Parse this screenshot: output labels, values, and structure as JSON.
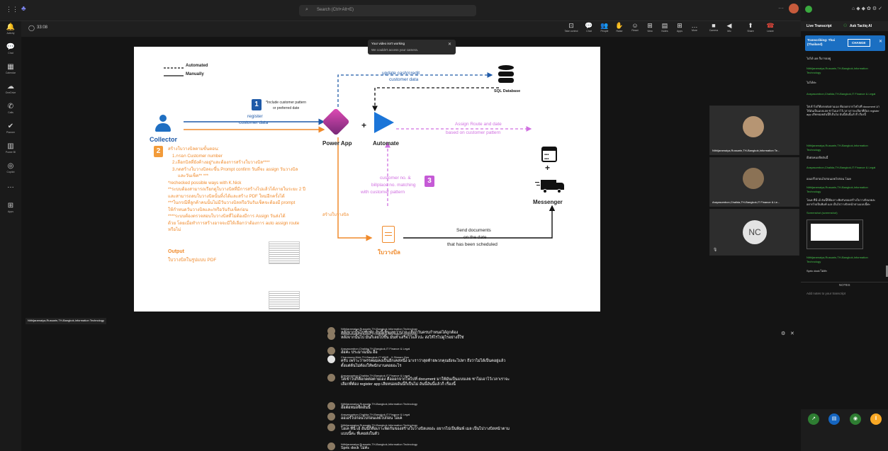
{
  "topbar": {
    "search_placeholder": "Search (Ctrl+Alt+E)"
  },
  "rail": [
    {
      "icon": "activity-icon",
      "glyph": "🔔",
      "label": "Activity"
    },
    {
      "icon": "chat-icon",
      "glyph": "💬",
      "label": "Chat"
    },
    {
      "icon": "calendar-icon",
      "glyph": "▦",
      "label": "Calendar"
    },
    {
      "icon": "onedrive-icon",
      "glyph": "☁",
      "label": "OneDrive"
    },
    {
      "icon": "calls-icon",
      "glyph": "✆",
      "label": "Calls"
    },
    {
      "icon": "planner-icon",
      "glyph": "✔",
      "label": "Planner"
    },
    {
      "icon": "powerbi-icon",
      "glyph": "▥",
      "label": "Power BI"
    },
    {
      "icon": "copilot-icon",
      "glyph": "◎",
      "label": "Copilot"
    },
    {
      "icon": "more-icon",
      "glyph": "…",
      "label": ""
    },
    {
      "icon": "apps-icon",
      "glyph": "⊞",
      "label": "Apps"
    }
  ],
  "meeting": {
    "timer": "33:08",
    "buttons": [
      {
        "name": "take-control",
        "glyph": "⊡",
        "label": "Take control"
      },
      {
        "name": "chat",
        "glyph": "💬",
        "label": "Chat"
      },
      {
        "name": "people",
        "glyph": "👥",
        "label": "People"
      },
      {
        "name": "raise",
        "glyph": "✋",
        "label": "Raise"
      },
      {
        "name": "react",
        "glyph": "☺",
        "label": "React"
      },
      {
        "name": "view",
        "glyph": "⊞",
        "label": "View"
      },
      {
        "name": "notes",
        "glyph": "▤",
        "label": "Notes"
      },
      {
        "name": "apps",
        "glyph": "⊞",
        "label": "Apps"
      },
      {
        "name": "more",
        "glyph": "…",
        "label": "More"
      },
      {
        "name": "camera",
        "glyph": "■",
        "label": "Camera"
      },
      {
        "name": "mic",
        "glyph": "◀",
        "label": "Mic"
      },
      {
        "name": "share",
        "glyph": "⬆",
        "label": "Share"
      },
      {
        "name": "leave",
        "glyph": "☎",
        "label": "Leave"
      }
    ],
    "toast_title": "Your video isn't working",
    "toast_body": "We couldn't access your camera.",
    "presenter_label": "Nithijaramaiya,Russarin,TH-Bangkok,Information Technology"
  },
  "slide": {
    "legend_automated": "Automated",
    "legend_manually": "Manually",
    "collector": "Collector",
    "step1_num": "1",
    "step1_note1": "*Include customer pattern",
    "step1_note2": "or preferred date",
    "register": "register",
    "customer_data": "customer data",
    "update1": "update cash/credit",
    "update2": "customer data",
    "sql": "SQL Database",
    "power_app": "Power App",
    "plus": "+",
    "automate": "Automate",
    "assign1": "Assign Route and date",
    "assign2": "based on customer pattern",
    "step2_num": "2",
    "notes": [
      "สร้างใบวางบิลตามขั้นตอน:",
      "1.กรอก Customer number",
      "2.เลือกบิลที่ยังค้างอยู่*และต้องการสร้างใบวางบิล****",
      "3.กดสร้างใบวางบิลจะขึ้น Prompt confirm วันที่จะ assign วันวางบิล",
      "และวันเช็ค** ***",
      "*rechecked possible ways with K.Nick",
      "**ระบบต้องสามารถเรียกดูใบวางบิลที่มีการสร้างไปแล้วได้ภายในระยะ 2 ปี",
      "และสามารถลบใบวางบิลนั้นทิ้งได้และสร้าง PDF ใหม่อีกครั้งได้",
      "***ในกรณีที่ลูกค้าคนนั้นไม่มีวันวางบิลหรือวันรับเช็คจะต้องมี prompt",
      "ให้กำหนดวันวางบิลและ/หรือวันรับเช็คก่อน",
      "****ระบบต้องตรวจสอบใบวางบิลที่ไม่ต้องมีการ Assign วันส่งได้",
      "ด้วย โดยเมื่อทำการสร้างอาจจะมีให้เลือกว่าต้องการ auto assign route",
      "หรือไม่"
    ],
    "output_title": "Output",
    "output_desc": "ใบวางบิลในรูปแบบ PDF",
    "step3_num": "3",
    "cust1": "customer no. &",
    "cust2": "billplace no. matching",
    "cust3": "with customer pattern",
    "create_bill": "สร้างใบวางบิล",
    "bill_label": "ใบวางบิล",
    "send1": "Send documents",
    "send2": "on the date",
    "send3": "that has been scheduled",
    "messenger": "Messenger"
  },
  "captions": [
    {
      "name": "Nithijaramaiya,Russarin,TH-Bangkok,Information Technology",
      "text": "หลังจากนั้นไปซักพัก อันนี้เห็นเลยว่าน่าจะเลือกวันครบกำหนดได้ถูกต้อง"
    },
    {
      "name": "Nithijaramaiya,Russarin,TH-Bangkok,Information Technology",
      "text": "หลังจากนั้นไป มันก็เลยไปขึ้น มันทำเสร็จไว้แล้วปะ ส่งให้ไรไปดูไรอย่างงี้ใช่"
    },
    {
      "name": "Arayasombon,Chalida,TH-Bangkok,IT Finance & Legal",
      "text": "อ๋อค่ะ ประมาณนั้น อือ"
    },
    {
      "name": "Chanmong,Nick,TH-Bangkok,IT WMS - X-Stream Ops",
      "text": "ครับ เพราะว่าพรรคผมคงเป็นอีกเคสหนึ่ง มาเราว่าสุดท้ายพวกคุณยังจะไปหา ถึงว่าไม่ได้เป็นคอยู่แล้วตั้งแต่ต้นไม่ต้องให้พนักงานคอยอะไร"
    },
    {
      "name": "Arayasombon,Chalida,TH-Bangkok,IT Finance & Legal",
      "text": "ใส่เข้าไปก็คือกดต่อตามเอง คือออกจากไฟไปที่ document มาให้มันเป็นแบบเลย ซาไม่เอาไว้เวลาเราจะเลือกที่ต้อง register app เสียหน่อยอันนี้ก็เป็นไม่ อันนี้อันนี้แล้วก็ เรื่องนี้"
    },
    {
      "name": "Nithijaramaiya,Russarin,TH-Bangkok,Information Technology",
      "text": "อ๊อต่อหมอจืดอันนี้"
    },
    {
      "name": "Arayasombon,Chalida,TH-Bangkok,IT Finance & Legal",
      "text": "ออเอร์ไปก่อนไปก่อนเลยไปก่อน โอเค"
    },
    {
      "name": "Nithijaramaiya,Russarin,TH-Bangkok,Information Technology",
      "text": "โอเค ที่นี่ เอ้ อันนี้ก็คือเกาะพิดกันของสร้างใบวางบิลเลยง่ะ อยากไปเป็นพิมพ์ เมล เป็นไปวางบิลหน้าตามแบบนี้ค่ะ ที่เคยส่งในตัว"
    },
    {
      "name": "Nithijaramaiya,Russarin,TH-Bangkok,Information Technology",
      "text": "Spric dock ไม่ค่ะ"
    }
  ],
  "participants": [
    {
      "name": "Nithijaramaiya,Russarin,TH-Bangkok,Information Te..."
    },
    {
      "name": "Arayasombon,Chalida,TH-Bangkok,IT Finance & Le..."
    },
    {
      "initials": "NC"
    }
  ],
  "rightpanel": {
    "tab_transcript": "Live Transcript",
    "tab_ask": "Ask Tactiq AI",
    "lang_label": "Transcribing: Thai (Thailand)",
    "change_btn": "CHANGE",
    "entries": [
      {
        "name": "",
        "text": "ไม่ได้ เอย ก็มารออยู่"
      },
      {
        "name": "Nithijaramaiya,Russarin,TH-Bangkok,Information Technology",
        "text": "ไม่ได้ค่ะ"
      },
      {
        "name": "Arayasombon,Chalida,TH-Bangkok,IT Finance & Legal",
        "text": "ใส่เข้าไปก็คือกดต่อตามเอง คือออกจากไฟไปที่ document มาให้มันเป็นแบบเลย ซาไม่เอาไว้เวลาเราจะเลือกที่ต้อง register app เสียหน่อยอันนี้ก็เป็นไม่ อันนี้อันนี้แล้วก็ เรื่องนี้"
      },
      {
        "name": "Nithijaramaiya,Russarin,TH-Bangkok,Information Technology",
        "text": "อ๊อต่อหมอจืดอันนี้"
      },
      {
        "name": "Arayasombon,Chalida,TH-Bangkok,IT Finance & Legal",
        "text": "ออเอร์ไปก่อนไปก่อนเลยไปก่อน โอเค"
      },
      {
        "name": "Nithijaramaiya,Russarin,TH-Bangkok,Information Technology",
        "text": "โอเค ที่นี่ เอ้ อันนี้ก็คือเกาะพิดกันของสร้างใบวางบิลเลยง่ะ อยากไปเป็นพิมพ์ เมล เป็นไปวางบิลหน้าตามแบบนี้ค่ะ"
      }
    ],
    "screenshot_label": "Screenshot (screenshot)",
    "last_name": "Nithijaramaiya,Russarin,TH-Bangkok,Information Technology",
    "last_text": "Spric dock ไม่ค่ะ",
    "notes_title": "NOTES",
    "notes_placeholder": "Add notes to your transcript"
  }
}
